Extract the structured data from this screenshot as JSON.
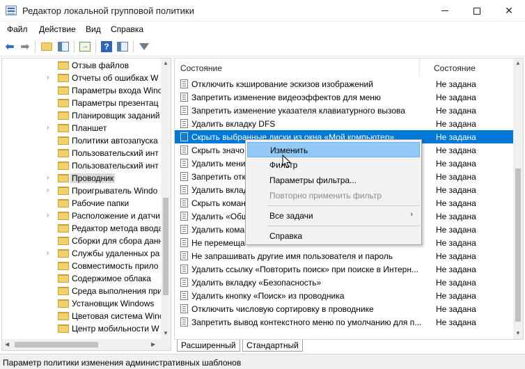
{
  "window": {
    "title": "Редактор локальной групповой политики",
    "minimize_glyph": "—",
    "maximize_glyph": "☐",
    "close_glyph": "✕"
  },
  "menu": [
    "Файл",
    "Действие",
    "Вид",
    "Справка"
  ],
  "toolbar": {
    "icons": [
      "back-arrow-icon",
      "forward-arrow-icon",
      "up-folder-icon",
      "show-hide-tree-icon",
      "export-list-icon",
      "help-icon",
      "properties-icon",
      "filter-icon"
    ],
    "help_glyph": "?",
    "export_glyph": "→"
  },
  "tree": {
    "items": [
      {
        "label": "Отзыв файлов",
        "expandable": false
      },
      {
        "label": "Отчеты об ошибках W",
        "expandable": true
      },
      {
        "label": "Параметры входа Winc",
        "expandable": false
      },
      {
        "label": "Параметры презентац",
        "expandable": false
      },
      {
        "label": "Планировщик заданий",
        "expandable": false
      },
      {
        "label": "Планшет",
        "expandable": true
      },
      {
        "label": "Политики автозапуска",
        "expandable": false
      },
      {
        "label": "Пользовательский инт",
        "expandable": false
      },
      {
        "label": "Пользовательский инт",
        "expandable": false
      },
      {
        "label": "Проводник",
        "expandable": true,
        "selected": true
      },
      {
        "label": "Проигрыватель Windo",
        "expandable": true
      },
      {
        "label": "Рабочие папки",
        "expandable": false
      },
      {
        "label": "Расположение и датчи",
        "expandable": true
      },
      {
        "label": "Редактор метода ввода",
        "expandable": false
      },
      {
        "label": "Сборки для сбора данн",
        "expandable": false
      },
      {
        "label": "Службы удаленных ра",
        "expandable": true
      },
      {
        "label": "Совместимость прило",
        "expandable": false
      },
      {
        "label": "Содержимое облака",
        "expandable": false
      },
      {
        "label": "Среда выполнения при",
        "expandable": false
      },
      {
        "label": "Установщик Windows",
        "expandable": false
      },
      {
        "label": "Цветовая система Winc",
        "expandable": false
      },
      {
        "label": "Центр мобильности W",
        "expandable": false
      }
    ]
  },
  "list": {
    "header_section": "Состояние",
    "header_state": "Состояние",
    "rows": [
      {
        "name": "Отключить кэширование эскизов изображений",
        "state": "Не задана"
      },
      {
        "name": "Запретить изменение видеоэффектов для меню",
        "state": "Не задана"
      },
      {
        "name": "Запретить изменение указателя клавиатурного вызова",
        "state": "Не задана"
      },
      {
        "name": "Удалить вкладку DFS",
        "state": "Не задана"
      },
      {
        "name": "Скрыть выбранные диски из окна «Мой компьютер»",
        "state": "Не задана",
        "selected": true
      },
      {
        "name": "Скрыть значо",
        "state": "Не задана"
      },
      {
        "name": "Удалить мени",
        "state": "Не задана"
      },
      {
        "name": "Запретить отк",
        "state": "Не задана"
      },
      {
        "name": "Удалить вклад",
        "state": "Не задана"
      },
      {
        "name": "Скрыть коман",
        "state": "Не задана"
      },
      {
        "name": "Удалить «Общ",
        "state": "Не задана"
      },
      {
        "name": "Удалить коман",
        "state": "Не задана"
      },
      {
        "name": "Не перемеща",
        "state": "Не задана"
      },
      {
        "name": "Не запрашивать другие имя пользователя и пароль",
        "state": "Не задана"
      },
      {
        "name": "Удалить ссылку «Повторить поиск» при поиске в Интерн...",
        "state": "Не задана"
      },
      {
        "name": "Удалить вкладку «Безопасность»",
        "state": "Не задана"
      },
      {
        "name": "Удалить кнопку «Поиск» из проводника",
        "state": "Не задана"
      },
      {
        "name": "Отключить числовую сортировку в проводнике",
        "state": "Не задана"
      },
      {
        "name": "Запретить вывод контекстного меню по умолчанию для п...",
        "state": "Не задана"
      }
    ]
  },
  "context_menu": {
    "items": [
      {
        "label": "Изменить",
        "highlighted": true
      },
      {
        "label": "Фильтр"
      },
      {
        "label": "Параметры фильтра..."
      },
      {
        "label": "Повторно применить фильтр",
        "disabled": true
      },
      {
        "label": "Все задачи",
        "submenu": true
      },
      {
        "label": "Справка"
      }
    ],
    "submenu_glyph": "›"
  },
  "tabs": [
    "Расширенный",
    "Стандартный"
  ],
  "status": "Параметр политики изменения административных шаблонов"
}
